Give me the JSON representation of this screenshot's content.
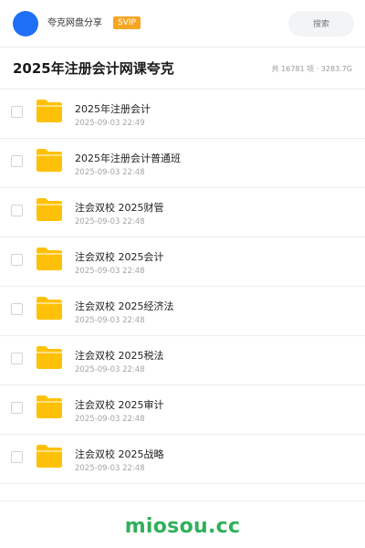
{
  "header": {
    "user_name": "夸克网盘分享",
    "badge": "SVIP",
    "search_placeholder": "搜索"
  },
  "colors": {
    "avatar": "#1e6ff5",
    "badge": "#f5a623",
    "folder": "#ffc107",
    "brand": "#2fb05a"
  },
  "share": {
    "title": "2025年注册会计网课夸克",
    "summary": "共 16781 项 · 3283.7G"
  },
  "files": [
    {
      "name": "2025年注册会计",
      "date": "2025-09-03 22:49",
      "icon": "folder-icon"
    },
    {
      "name": "2025年注册会计普通班",
      "date": "2025-09-03 22:48",
      "icon": "folder-icon"
    },
    {
      "name": "注会双校 2025财管",
      "date": "2025-09-03 22:48",
      "icon": "folder-icon"
    },
    {
      "name": "注会双校 2025会计",
      "date": "2025-09-03 22:48",
      "icon": "folder-icon"
    },
    {
      "name": "注会双校 2025经济法",
      "date": "2025-09-03 22:48",
      "icon": "folder-icon"
    },
    {
      "name": "注会双校 2025税法",
      "date": "2025-09-03 22:48",
      "icon": "folder-icon"
    },
    {
      "name": "注会双校 2025审计",
      "date": "2025-09-03 22:48",
      "icon": "folder-icon"
    },
    {
      "name": "注会双校 2025战略",
      "date": "2025-09-03 22:48",
      "icon": "folder-icon"
    }
  ],
  "footer": {
    "brand": "miosou.cc"
  }
}
